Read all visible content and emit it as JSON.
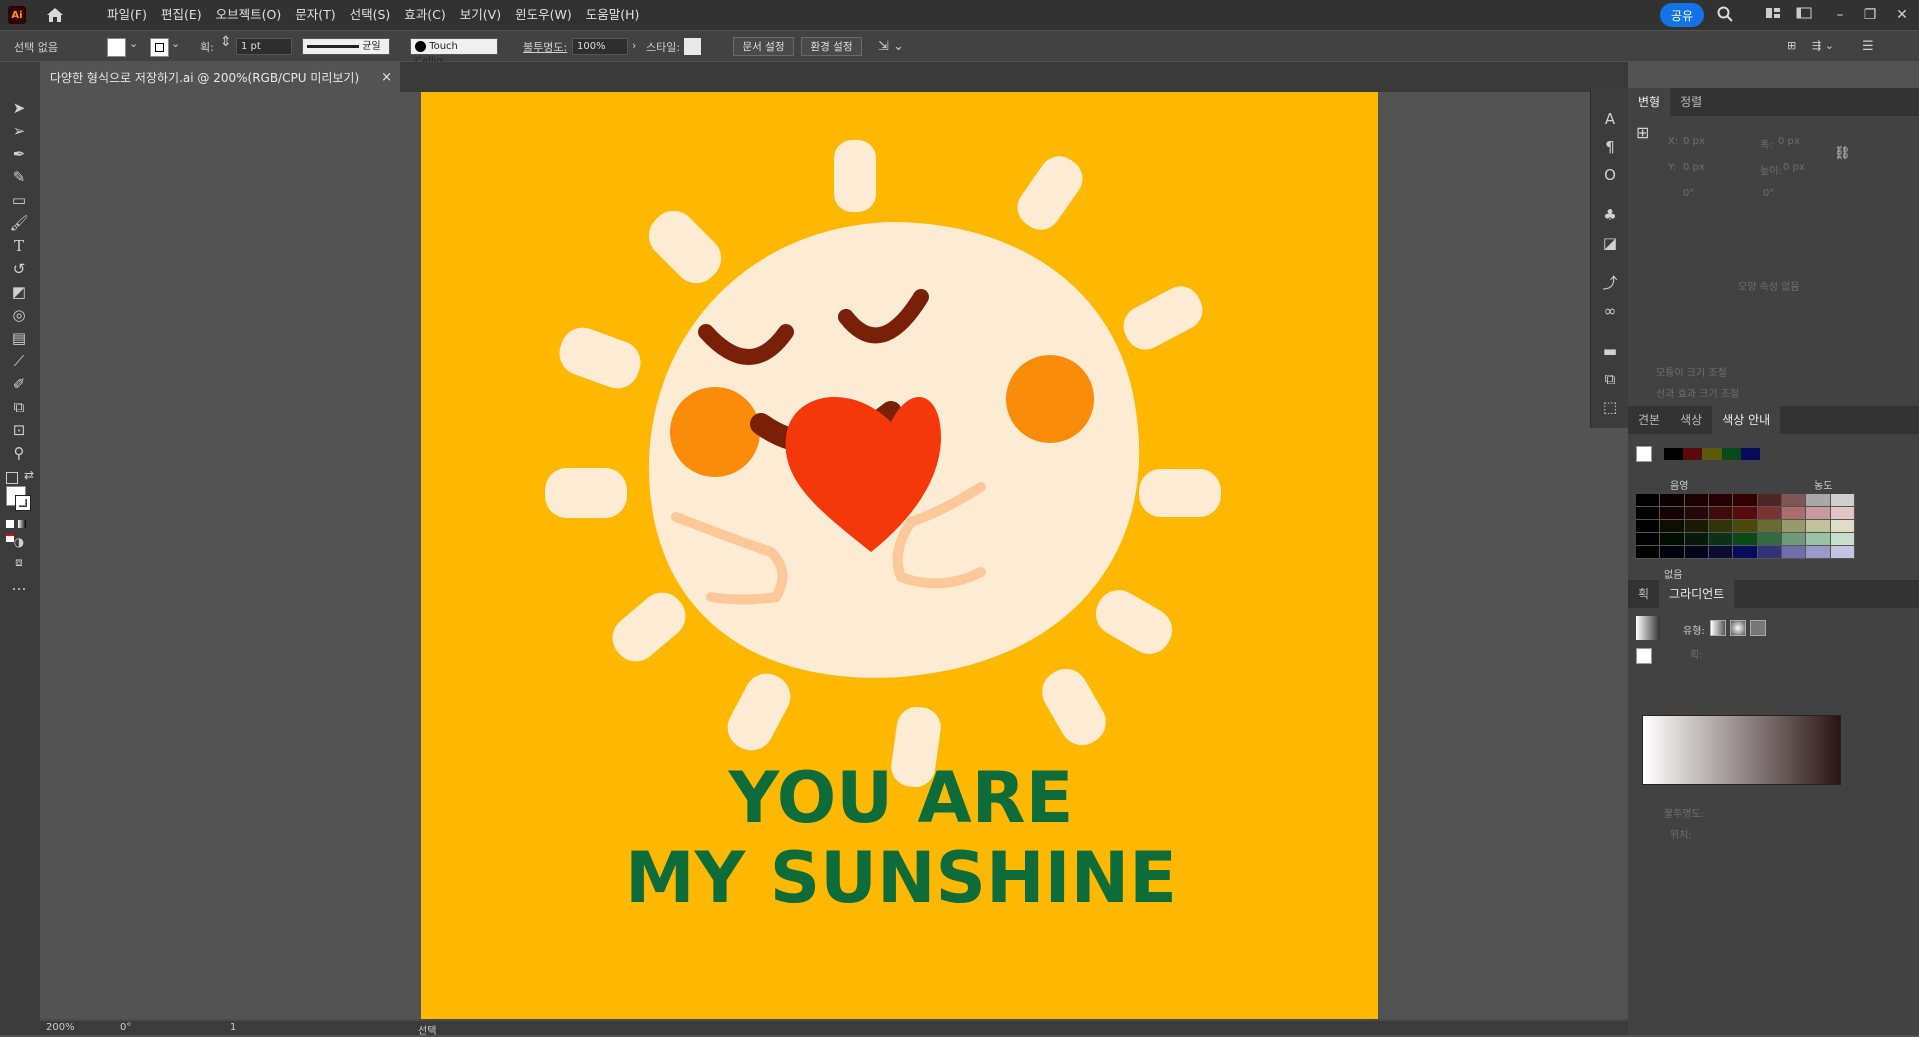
{
  "app": {
    "logo": "Ai",
    "menus": [
      "파일(F)",
      "편집(E)",
      "오브젝트(O)",
      "문자(T)",
      "선택(S)",
      "효과(C)",
      "보기(V)",
      "윈도우(W)",
      "도움말(H)"
    ],
    "share_label": "공유"
  },
  "control_bar": {
    "selection_label": "선택 없음",
    "stroke_label": "획:",
    "stroke_weight": "1 pt",
    "stroke_profile": "균일",
    "brush": "Touch Callig...",
    "opacity_label": "불투명도:",
    "opacity_value": "100%",
    "style_label": "스타일:",
    "doc_setup_button": "문서 설정",
    "preferences_button": "환경 설정"
  },
  "document_tab": {
    "title": "다양한 형식으로 저장하기.ai @ 200%(RGB/CPU 미리보기)",
    "close": "×"
  },
  "artwork": {
    "line1": "YOU ARE",
    "line2": "MY SUNSHINE",
    "background_color": "#feb801",
    "text_color": "#0e6b3a",
    "sun_color": "#feebd4",
    "cheek_color": "#fa8c0a",
    "face_color": "#7a2008",
    "heart_color": "#f4380a"
  },
  "status_bar": {
    "zoom": "200%",
    "rotation": "0°",
    "page": "1",
    "tool": "선택"
  },
  "transform_panel": {
    "tabs": [
      "변형",
      "정렬"
    ],
    "x_label": "X:",
    "x_value": "0 px",
    "y_label": "Y:",
    "y_value": "0 px",
    "w_label": "폭:",
    "w_value": "0 px",
    "h_label": "높이:",
    "h_value": "0 px",
    "angle_value": "0°",
    "shear_value": "0°",
    "no_selection": "모양 속성 없음",
    "scale_corners": "모퉁이 크기 조절",
    "scale_strokes": "선과 효과 크기 조절"
  },
  "color_panel": {
    "tabs": [
      "견본",
      "색상",
      "색상 안내"
    ],
    "col_name": "음영",
    "col_tint": "농도",
    "footer_label": "없음"
  },
  "gradient_panel": {
    "tabs": [
      "획",
      "그라디언트"
    ],
    "type_label": "유형:",
    "stroke_label": "획:",
    "opacity_label": "불투명도:",
    "location_label": "위치:"
  }
}
